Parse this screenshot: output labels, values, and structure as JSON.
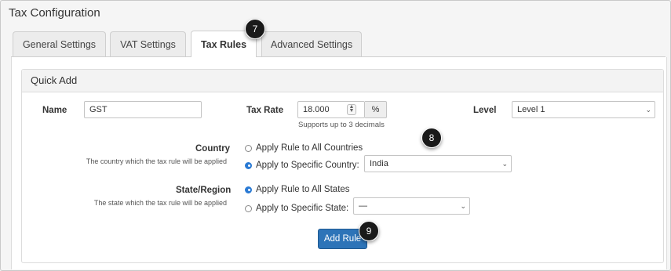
{
  "page_title": "Tax Configuration",
  "tabs": [
    {
      "label": "General Settings"
    },
    {
      "label": "VAT Settings"
    },
    {
      "label": "Tax Rules"
    },
    {
      "label": "Advanced Settings"
    }
  ],
  "panel": {
    "title": "Quick Add",
    "name_label": "Name",
    "name_value": "GST",
    "tax_rate_label": "Tax Rate",
    "tax_rate_value": "18.000",
    "tax_rate_unit": "%",
    "tax_rate_note": "Supports up to 3 decimals",
    "level_label": "Level",
    "level_value": "Level 1",
    "country_label": "Country",
    "country_help": "The country which the tax rule will be applied",
    "country_option_all": "Apply Rule to All Countries",
    "country_option_specific": "Apply to Specific Country:",
    "country_value": "India",
    "state_label": "State/Region",
    "state_help": "The state which the tax rule will be applied",
    "state_option_all": "Apply Rule to All States",
    "state_option_specific": "Apply to Specific State:",
    "state_value": "—",
    "add_rule_label": "Add Rule"
  },
  "markers": [
    "7",
    "8",
    "9"
  ],
  "icons": {
    "chevron": "chevron-down-icon",
    "spinner": "spinner-icon"
  },
  "colors": {
    "primary_button": "#2d74b8",
    "radio_selected": "#2a7ad4",
    "marker": "#1a1a1a"
  }
}
